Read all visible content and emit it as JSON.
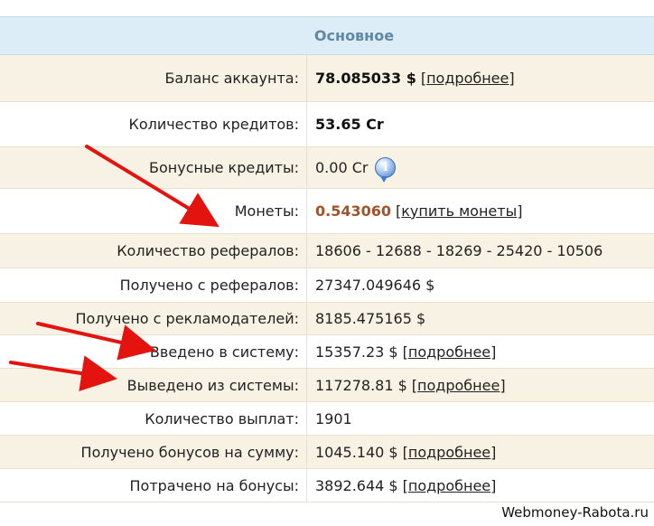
{
  "section": {
    "title": "Основное"
  },
  "rows": [
    {
      "label": "Баланс аккаунта:",
      "value": "78.085033 $",
      "link": "подробнее"
    },
    {
      "label": "Количество кредитов:",
      "value": "53.65 Cr"
    },
    {
      "label": "Бонусные кредиты:",
      "value": "0.00 Cr",
      "icon": "info-icon"
    },
    {
      "label": "Монеты:",
      "value": "0.543060",
      "link": "купить монеты"
    },
    {
      "label": "Количество рефералов:",
      "value": "18606 - 12688 - 18269 - 25420 - 10506"
    },
    {
      "label": "Получено с рефералов:",
      "value": "27347.049646 $"
    },
    {
      "label": "Получено с рекламодателей:",
      "value": "8185.475165 $"
    },
    {
      "label": "Введено в систему:",
      "value": "15357.23 $",
      "link": "подробнее"
    },
    {
      "label": "Выведено из системы:",
      "value": "117278.81 $",
      "link": "подробнее"
    },
    {
      "label": "Количество выплат:",
      "value": "1901"
    },
    {
      "label": "Получено бонусов на сумму:",
      "value": "1045.140 $",
      "link": "подробнее"
    },
    {
      "label": "Потрачено на бонусы:",
      "value": "3892.644 $",
      "link": "подробнее"
    }
  ],
  "colors": {
    "header_bg": "#dcedf7",
    "header_text": "#5f88a3",
    "row_alt_bg": "#f7f2e3",
    "coins_value": "#a0542a",
    "arrow": "#e3130f"
  },
  "watermark": "Webmoney-Rabota.ru"
}
